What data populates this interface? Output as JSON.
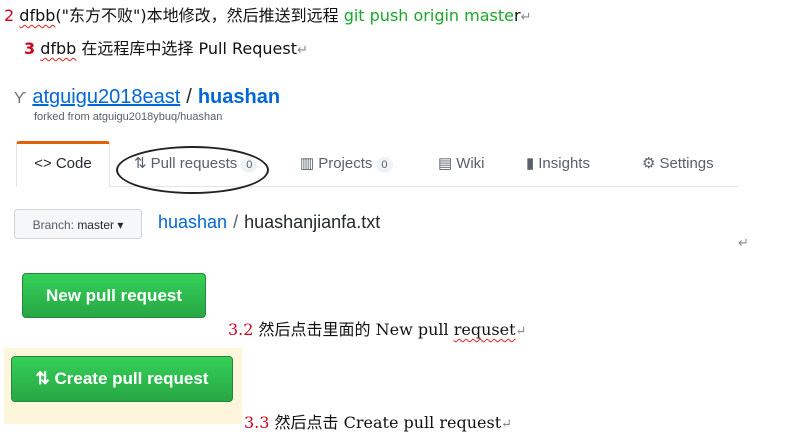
{
  "doc": {
    "line1": {
      "num": "2",
      "tool": "dfbb",
      "text_mid": "(\"东方不败\")本地修改，然后推送到远程 ",
      "cmd": "git push origin maste",
      "tail": "r",
      "mark": "↵"
    },
    "line2": {
      "num": "3",
      "tool": "dfbb",
      "text": " 在远程库中选择 Pull Request",
      "mark": "↵"
    },
    "step_a": {
      "num": "3.2",
      "text": " 然后点击里面的 New pull ",
      "word": "requset",
      "mark": "↵"
    },
    "step_b": {
      "num": "3.3",
      "text": " 然后点击 Create pull request",
      "mark": "↵"
    },
    "return_mark": "↵"
  },
  "github": {
    "owner": "atguigu2018east",
    "sep": "/",
    "repo": "huashan",
    "forked_prefix": "forked from ",
    "forked_source": "atguigu2018ybuq/huashan",
    "tabs": [
      {
        "icon": "<>",
        "label": "Code",
        "count": ""
      },
      {
        "icon": "⇅",
        "label": "Pull requests",
        "count": "0"
      },
      {
        "icon": "▥",
        "label": "Projects",
        "count": "0"
      },
      {
        "icon": "▤",
        "label": "Wiki",
        "count": ""
      },
      {
        "icon": "▮",
        "label": "Insights",
        "count": ""
      },
      {
        "icon": "⚙",
        "label": "Settings",
        "count": ""
      }
    ],
    "branch_prefix": "Branch: ",
    "branch": "master",
    "breadcrumb_repo": "huashan",
    "breadcrumb_sep": "/",
    "breadcrumb_file": "huashanjianfa.txt",
    "new_pr_label": "New pull request",
    "create_pr_label": "Create pull request"
  },
  "colors": {
    "green": "#28a745",
    "link": "#0366d6",
    "red": "#d0021b"
  }
}
